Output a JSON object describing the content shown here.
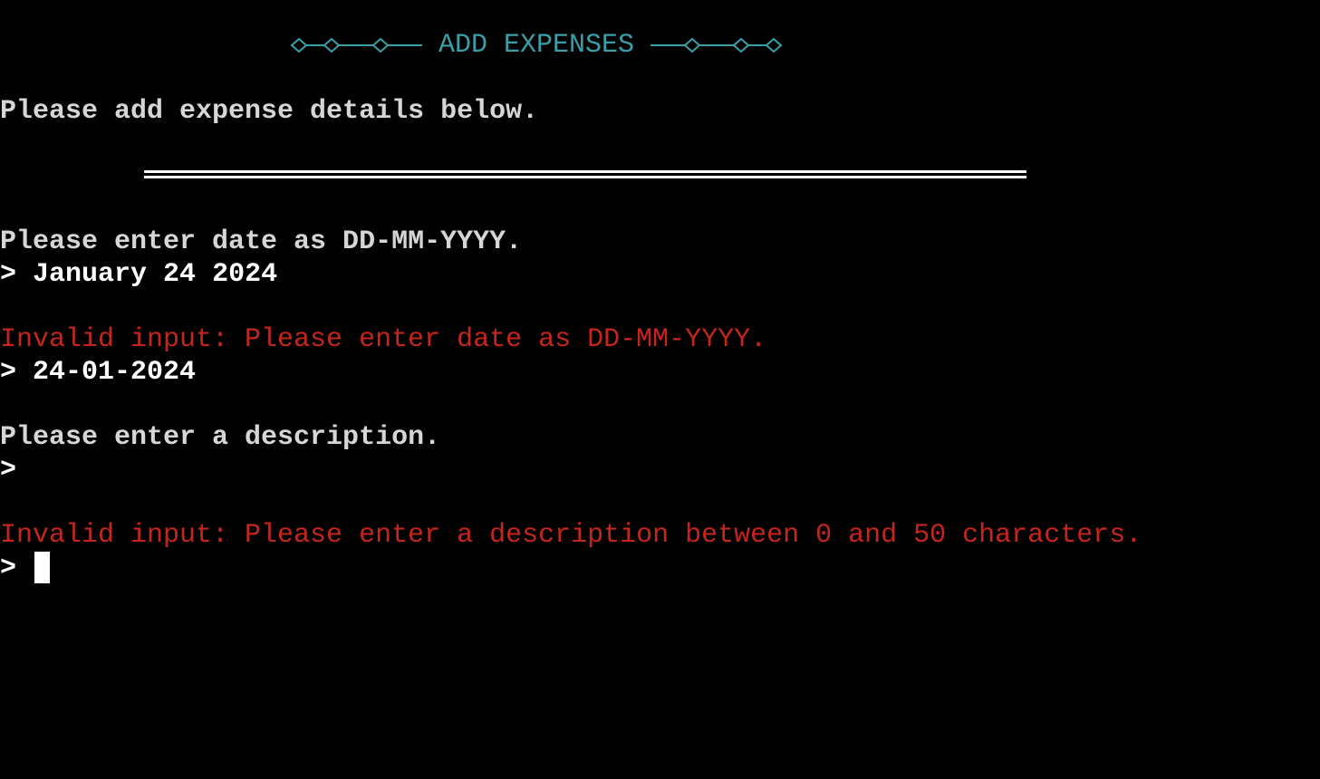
{
  "header": {
    "title": "ADD EXPENSES",
    "ornament_icon": "diamond-chain-icon",
    "color": "#3a9fa8"
  },
  "intro": "Please add expense details below.",
  "prompt_symbol": ">",
  "transcript": {
    "date_prompt": "Please enter date as DD-MM-YYYY.",
    "date_input_1": "January 24 2024",
    "date_error": "Invalid input: Please enter date as DD-MM-YYYY.",
    "date_input_2": "24-01-2024",
    "description_prompt": "Please enter a description.",
    "description_input_1": "",
    "description_error": "Invalid input: Please enter a description between 0 and 50 characters.",
    "description_input_2": ""
  },
  "colors": {
    "background": "#000000",
    "text": "#d6d6d6",
    "input": "#ffffff",
    "error": "#c4261d"
  }
}
